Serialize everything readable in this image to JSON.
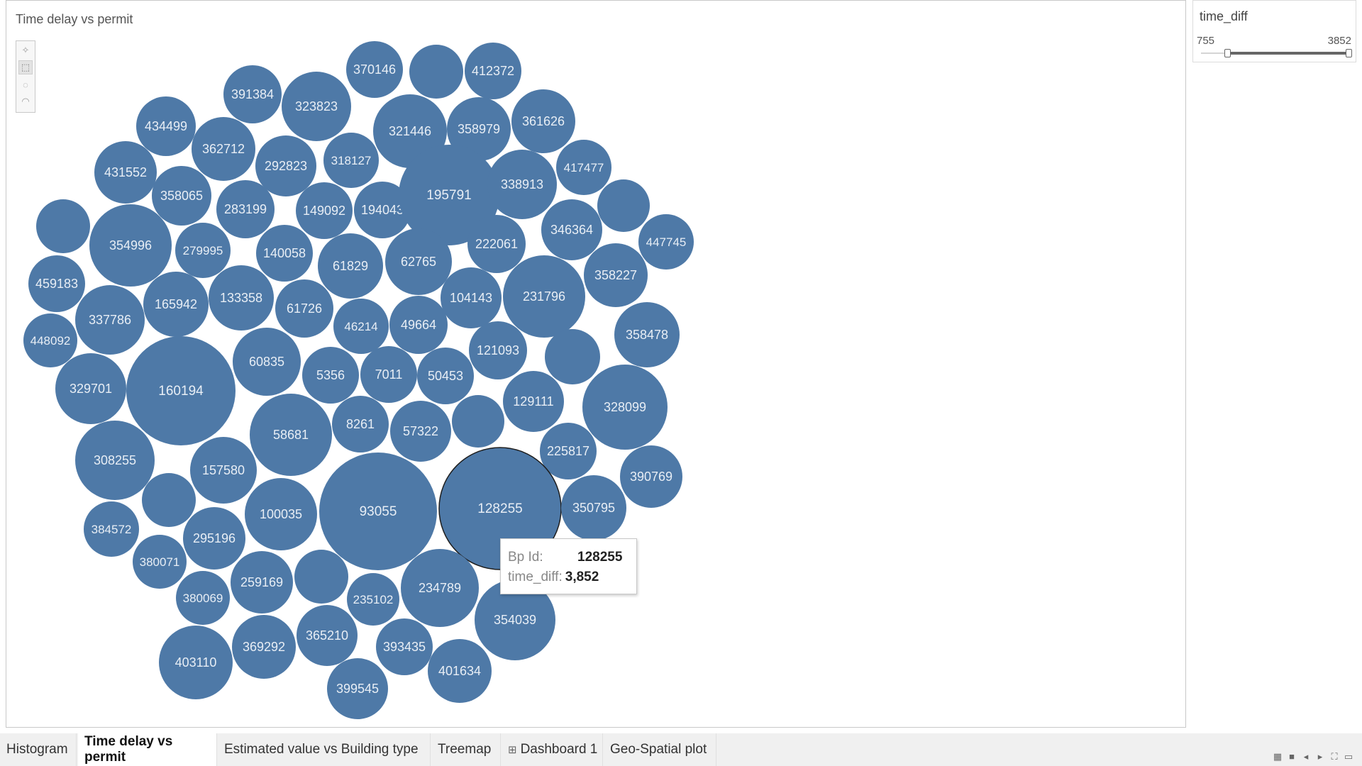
{
  "sheet": {
    "title": "Time delay vs permit"
  },
  "toolbar": {
    "tools": [
      {
        "name": "pin-tool-icon",
        "glyph": "✧"
      },
      {
        "name": "rect-select-tool-icon",
        "glyph": "⬚"
      },
      {
        "name": "radial-select-tool-icon",
        "glyph": "◌"
      },
      {
        "name": "lasso-select-tool-icon",
        "glyph": "◠"
      }
    ]
  },
  "bubble_color": "#4e79a7",
  "highlight_color": "#1e1e1e",
  "bubbles": [
    "370146",
    "",
    "412372",
    "391384",
    "323823",
    "321446",
    "358979",
    "361626",
    "434499",
    "362712",
    "292823",
    "318127",
    "417477",
    "431552",
    "358065",
    "283199",
    "149092",
    "194043",
    "195791",
    "338913",
    "",
    "",
    "354996",
    "279995",
    "140058",
    "61829",
    "62765",
    "222061",
    "346364",
    "447745",
    "459183",
    "165942",
    "133358",
    "61726",
    "104143",
    "231796",
    "358227",
    "448092",
    "337786",
    "46214",
    "49664",
    "358478",
    "329701",
    "160194",
    "60835",
    "5356",
    "7011",
    "50453",
    "121093",
    "",
    "129111",
    "328099",
    "308255",
    "58681",
    "8261",
    "57322",
    "",
    "225817",
    "157580",
    "",
    "100035",
    "93055",
    "128255",
    "350795",
    "390769",
    "384572",
    "295196",
    "380071",
    "259169",
    "",
    "235102",
    "234789",
    "354039",
    "380069",
    "403110",
    "369292",
    "365210",
    "393435",
    "401634",
    "399545"
  ],
  "tooltip": {
    "bp_id_label": "Bp Id:",
    "bp_id_value": "128255",
    "time_diff_label": "time_diff:",
    "time_diff_value": "3,852"
  },
  "filter": {
    "title": "time_diff",
    "min": "755",
    "max": "3852"
  },
  "tabs": [
    {
      "label": "Histogram"
    },
    {
      "label": "Time delay vs permit"
    },
    {
      "label": "Estimated value vs Building type"
    },
    {
      "label": "Treemap"
    },
    {
      "label": "Dashboard 1"
    },
    {
      "label": "Geo-Spatial plot"
    }
  ]
}
